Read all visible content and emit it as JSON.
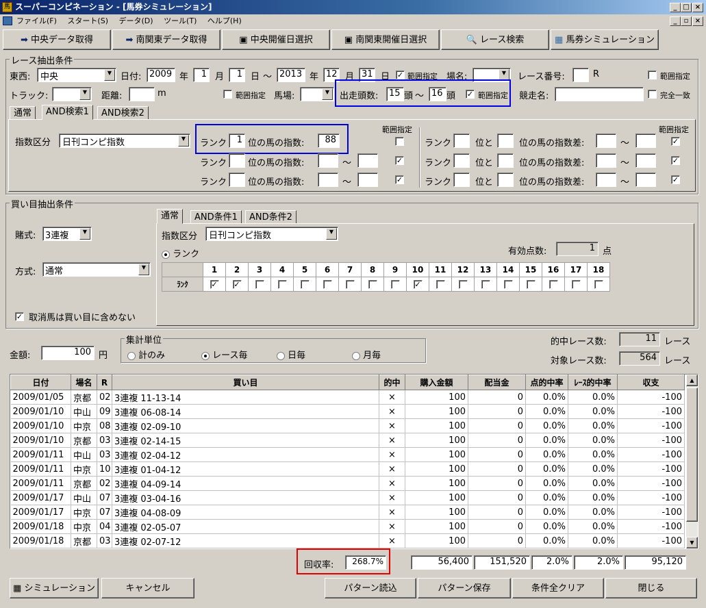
{
  "window": {
    "title": "スーパーコンピネーション - [馬券シミュレーション]",
    "icon": "app-icon"
  },
  "menu": [
    "ファイル(F)",
    "スタート(S)",
    "データ(D)",
    "ツール(T)",
    "ヘルプ(H)"
  ],
  "toolbar": [
    "中央データ取得",
    "南関東データ取得",
    "中央開催日選択",
    "南関東開催日選択",
    "レース検索",
    "馬券シミュレーション"
  ],
  "race": {
    "title": "レース抽出条件",
    "east_west_label": "東西:",
    "east_west": "中央",
    "date_label": "日付:",
    "y1": "2009",
    "m1": "1",
    "d1": "1",
    "y2": "2013",
    "m2": "12",
    "d2": "31",
    "nen": "年",
    "tsuki": "月",
    "nichi": "日",
    "tilde": "〜",
    "range_label": "範囲指定",
    "place_label": "場名:",
    "race_no_label": "レース番号:",
    "race_unit": "R",
    "track_label": "トラック:",
    "dist_label": "距離:",
    "dist_unit": "m",
    "baba_label": "馬場:",
    "starters_label": "出走頭数:",
    "starters_from": "15",
    "starters_to": "16",
    "tou": "頭",
    "race_name_label": "競走名:",
    "exact_label": "完全一致",
    "tabs": [
      "通常",
      "AND検索1",
      "AND検索2"
    ],
    "index_kubun_label": "指数区分",
    "index_kubun": "日刊コンピ指数",
    "rank_label": "ランク",
    "pos_label": "位の馬の指数:",
    "rank1": "1",
    "index1": "88",
    "pos_to_label": "位と",
    "diff_label": "位の馬の指数差:"
  },
  "buy": {
    "title": "買い目抽出条件",
    "shiki_label": "賭式:",
    "shiki": "3連複",
    "houshiki_label": "方式:",
    "houshiki": "通常",
    "tabs": [
      "通常",
      "AND条件1",
      "AND条件2"
    ],
    "index_kubun_label": "指数区分",
    "index_kubun": "日刊コンピ指数",
    "rank_radio": "ランク",
    "valid_label": "有効点数:",
    "valid_count": "1",
    "valid_unit": "点",
    "rank_row_label": "ﾗﾝｸ",
    "numbers": [
      "1",
      "2",
      "3",
      "4",
      "5",
      "6",
      "7",
      "8",
      "9",
      "10",
      "11",
      "12",
      "13",
      "14",
      "15",
      "16",
      "17",
      "18"
    ],
    "checked": [
      1,
      2,
      10
    ],
    "cancel_label": "取消馬は買い目に含めない"
  },
  "money": {
    "label": "金額:",
    "value": "100",
    "unit": "円"
  },
  "aggregate": {
    "title": "集計単位",
    "options": [
      "計のみ",
      "レース毎",
      "日毎",
      "月毎"
    ],
    "selected": 1
  },
  "stats": {
    "hit_label": "的中レース数:",
    "hit": "11",
    "target_label": "対象レース数:",
    "target": "564",
    "unit": "レース"
  },
  "table": {
    "headers": [
      "日付",
      "場名",
      "R",
      "買い目",
      "的中",
      "購入金額",
      "配当金",
      "点的中率",
      "ﾚｰｽ的中率",
      "収支"
    ],
    "rows": [
      [
        "2009/01/05",
        "京都",
        "02",
        "3連複 11-13-14",
        "×",
        "100",
        "0",
        "0.0%",
        "0.0%",
        "-100"
      ],
      [
        "2009/01/10",
        "中山",
        "09",
        "3連複 06-08-14",
        "×",
        "100",
        "0",
        "0.0%",
        "0.0%",
        "-100"
      ],
      [
        "2009/01/10",
        "中京",
        "08",
        "3連複 02-09-10",
        "×",
        "100",
        "0",
        "0.0%",
        "0.0%",
        "-100"
      ],
      [
        "2009/01/10",
        "京都",
        "03",
        "3連複 02-14-15",
        "×",
        "100",
        "0",
        "0.0%",
        "0.0%",
        "-100"
      ],
      [
        "2009/01/11",
        "中山",
        "03",
        "3連複 02-04-12",
        "×",
        "100",
        "0",
        "0.0%",
        "0.0%",
        "-100"
      ],
      [
        "2009/01/11",
        "中京",
        "10",
        "3連複 01-04-12",
        "×",
        "100",
        "0",
        "0.0%",
        "0.0%",
        "-100"
      ],
      [
        "2009/01/11",
        "京都",
        "02",
        "3連複 04-09-14",
        "×",
        "100",
        "0",
        "0.0%",
        "0.0%",
        "-100"
      ],
      [
        "2009/01/17",
        "中山",
        "07",
        "3連複 03-04-16",
        "×",
        "100",
        "0",
        "0.0%",
        "0.0%",
        "-100"
      ],
      [
        "2009/01/17",
        "中京",
        "07",
        "3連複 04-08-09",
        "×",
        "100",
        "0",
        "0.0%",
        "0.0%",
        "-100"
      ],
      [
        "2009/01/18",
        "中京",
        "04",
        "3連複 02-05-07",
        "×",
        "100",
        "0",
        "0.0%",
        "0.0%",
        "-100"
      ],
      [
        "2009/01/18",
        "京都",
        "03",
        "3連複 02-07-12",
        "×",
        "100",
        "0",
        "0.0%",
        "0.0%",
        "-100"
      ]
    ]
  },
  "totals": {
    "recovery_label": "回収率:",
    "recovery": "268.7%",
    "purchase": "56,400",
    "payout": "151,520",
    "point_hit": "2.0%",
    "race_hit": "2.0%",
    "balance": "95,120"
  },
  "buttons": {
    "simulate": "シミュレーション",
    "cancel": "キャンセル",
    "load": "パターン読込",
    "save": "パターン保存",
    "clear": "条件全クリア",
    "close": "閉じる"
  }
}
